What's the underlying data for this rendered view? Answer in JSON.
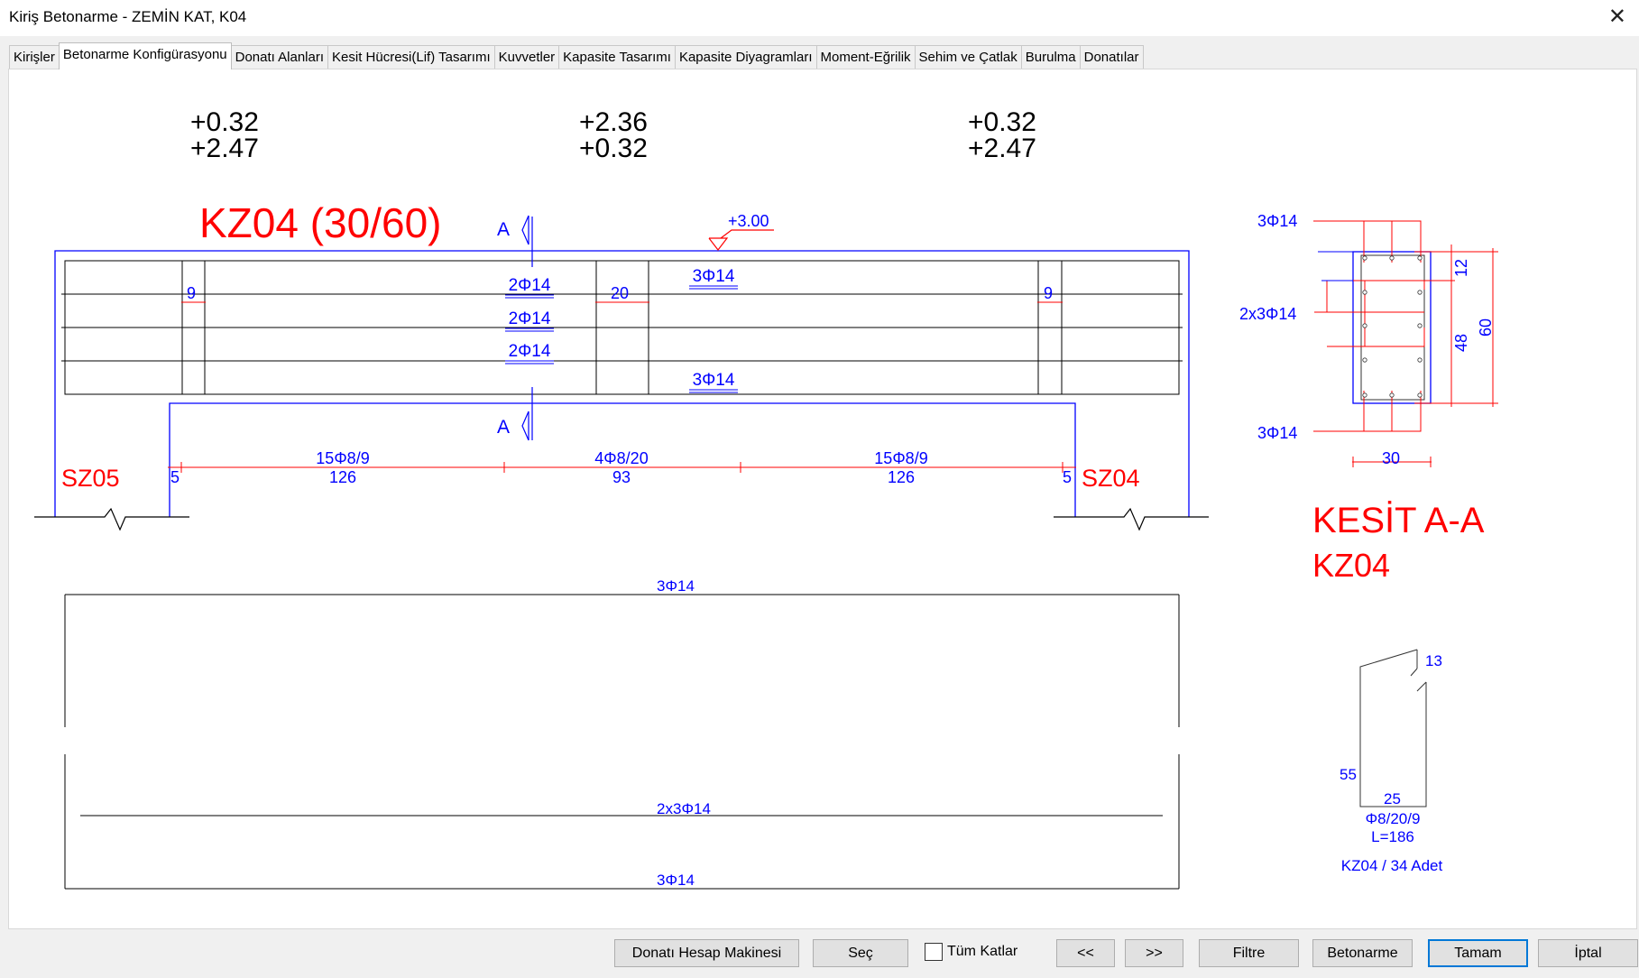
{
  "window": {
    "title": "Kiriş Betonarme - ZEMİN KAT, K04",
    "close_glyph": "✕"
  },
  "tabs": [
    {
      "label": "Kirişler"
    },
    {
      "label": "Betonarme Konfigürasyonu",
      "active": true
    },
    {
      "label": "Donatı Alanları"
    },
    {
      "label": "Kesit Hücresi(Lif) Tasarımı"
    },
    {
      "label": "Kuvvetler"
    },
    {
      "label": "Kapasite Tasarımı"
    },
    {
      "label": "Kapasite Diyagramları"
    },
    {
      "label": "Moment-Eğrilik"
    },
    {
      "label": "Sehim ve Çatlak"
    },
    {
      "label": "Burulma"
    },
    {
      "label": "Donatılar"
    }
  ],
  "drawing": {
    "colors": {
      "blue": "#0000ff",
      "red": "#ff0000",
      "black": "#000000",
      "gray": "#333333"
    },
    "ratios": {
      "left": [
        "+0.32",
        "+2.47"
      ],
      "mid": [
        "+2.36",
        "+0.32"
      ],
      "right": [
        "+0.32",
        "+2.47"
      ]
    },
    "beam_title": "KZ04 (30/60)",
    "section_mark": "A",
    "level_mark": "+3.00",
    "bars": {
      "top": "3Φ14",
      "web1": "2Φ14",
      "web2": "2Φ14",
      "web3": "2Φ14",
      "bottom": "3Φ14"
    },
    "dims": {
      "left_conf": "9",
      "mid": "20",
      "right_conf": "9"
    },
    "stirrups": {
      "left_spec": "15Φ8/9",
      "left_len": "126",
      "mid_spec": "4Φ8/20",
      "mid_len": "93",
      "right_spec": "15Φ8/9",
      "right_len": "126",
      "left_offset": "5",
      "right_offset": "5"
    },
    "columns": {
      "left": "SZ05",
      "right": "SZ04"
    },
    "section": {
      "title": "KESİT A-A",
      "subtitle": "KZ04",
      "top_bars": "3Φ14",
      "web_bars": "2x3Φ14",
      "bottom_bars": "3Φ14",
      "dim_top": "12",
      "dim_web": "48",
      "dim_total": "60",
      "dim_width": "30"
    },
    "elevation": {
      "top": "3Φ14",
      "mid": "2x3Φ14",
      "bottom": "3Φ14"
    },
    "stirrup_detail": {
      "hook": "13",
      "height": "55",
      "width": "25",
      "spec": "Φ8/20/9",
      "length": "L=186",
      "count": "KZ04 / 34 Adet"
    }
  },
  "buttons": {
    "calc": "Donatı Hesap Makinesi",
    "select": "Seç",
    "all_floors": "Tüm Katlar",
    "all_floors_checked": false,
    "prev": "<<",
    "next": ">>",
    "filter": "Filtre",
    "concrete": "Betonarme",
    "ok": "Tamam",
    "cancel": "İptal"
  }
}
